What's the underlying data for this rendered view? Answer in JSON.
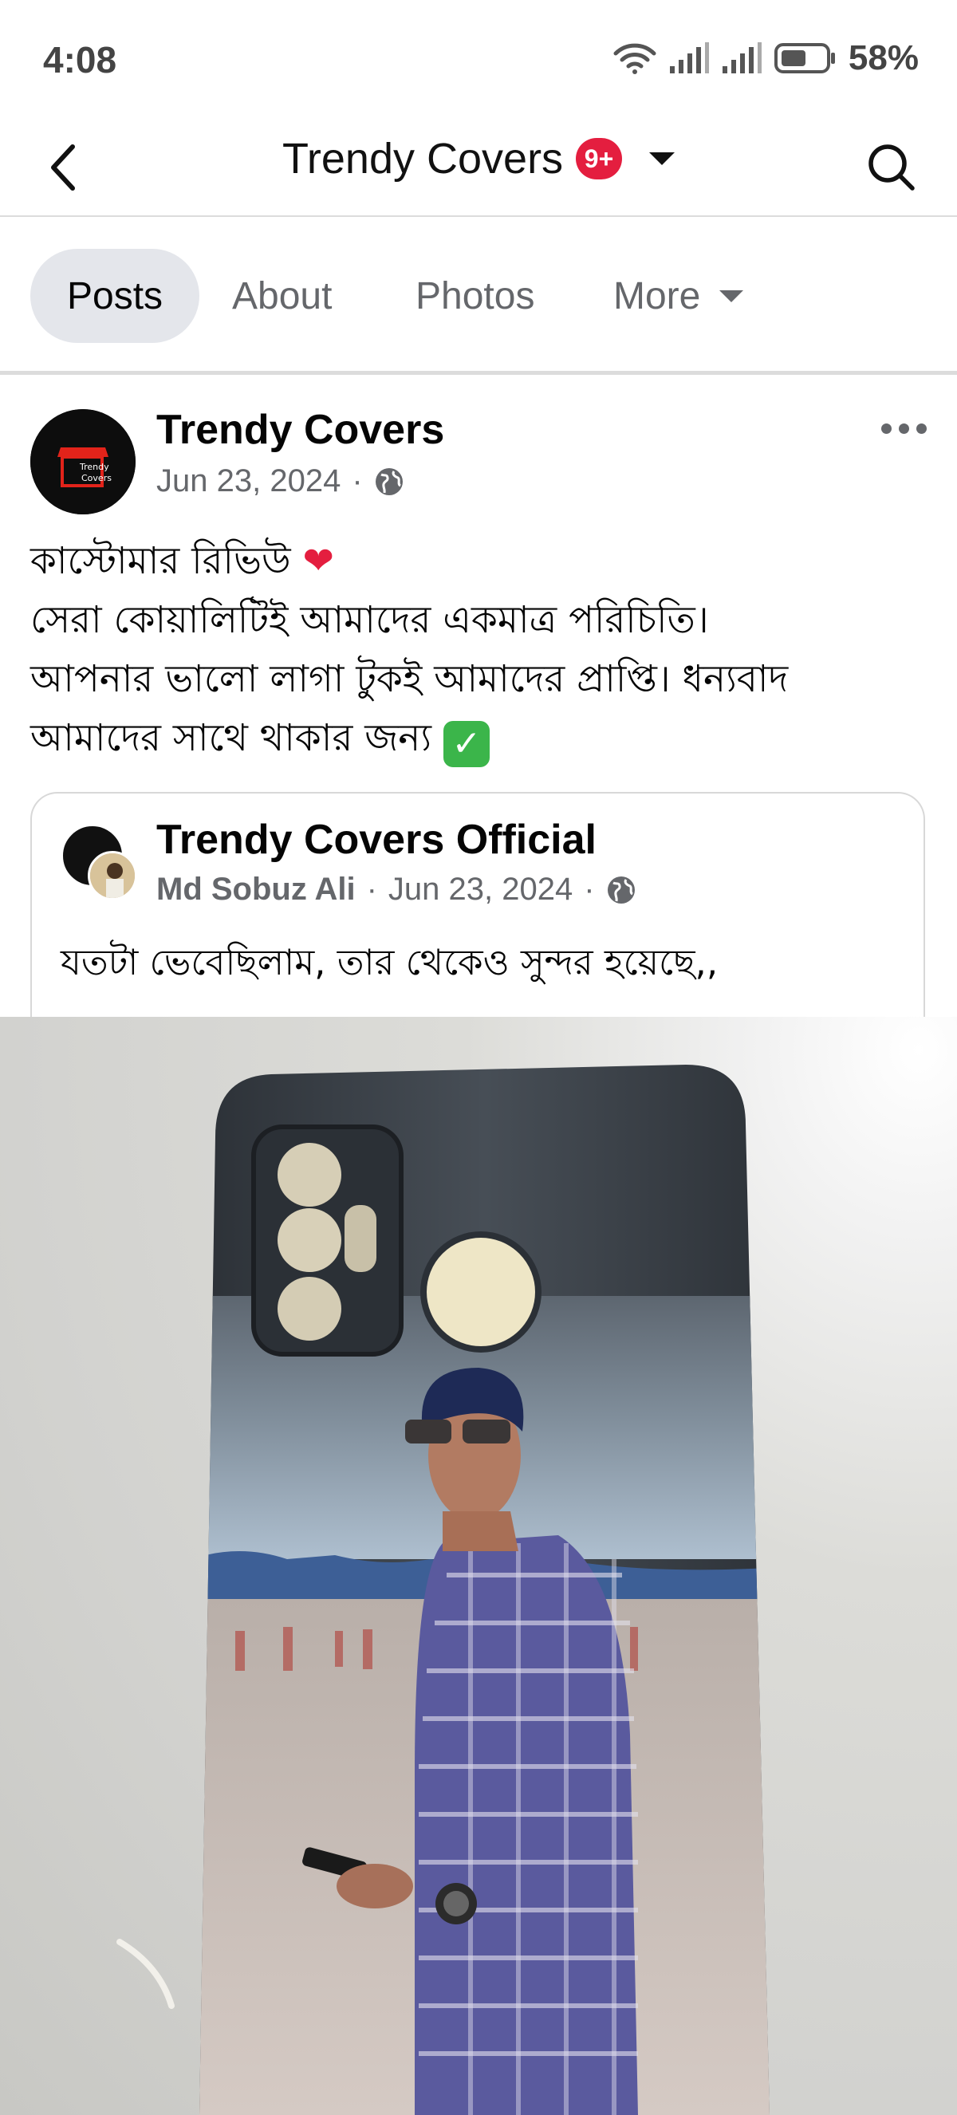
{
  "status_bar": {
    "time": "4:08",
    "battery": "58%"
  },
  "header": {
    "title": "Trendy Covers",
    "badge": "9+"
  },
  "tabs": [
    {
      "label": "Posts",
      "active": true
    },
    {
      "label": "About"
    },
    {
      "label": "Photos"
    },
    {
      "label": "More"
    }
  ],
  "post": {
    "author": "Trendy Covers",
    "date": "Jun 23, 2024",
    "text_lines": [
      "কাস্টোমার রিভিউ",
      "সেরা কোয়ালিটিই আমাদের একমাত্র পরিচিতি।",
      "আপনার ভালো লাগা টুকই আমাদের প্রাপ্তি। ধন্যবাদ",
      "আমাদের সাথে থাকার জন্য"
    ],
    "avatar_text": [
      "Trendy",
      "Covers"
    ]
  },
  "shared_post": {
    "page_name": "Trendy Covers Official",
    "author": "Md Sobuz Ali",
    "date": "Jun 23, 2024",
    "text": "যতটা ভেবেছিলাম, তার থেকেও সুন্দর হয়েছে,,"
  },
  "colors": {
    "accent_red": "#e41e3f",
    "secondary_text": "#65676b",
    "tab_active_bg": "#e4e6eb"
  }
}
